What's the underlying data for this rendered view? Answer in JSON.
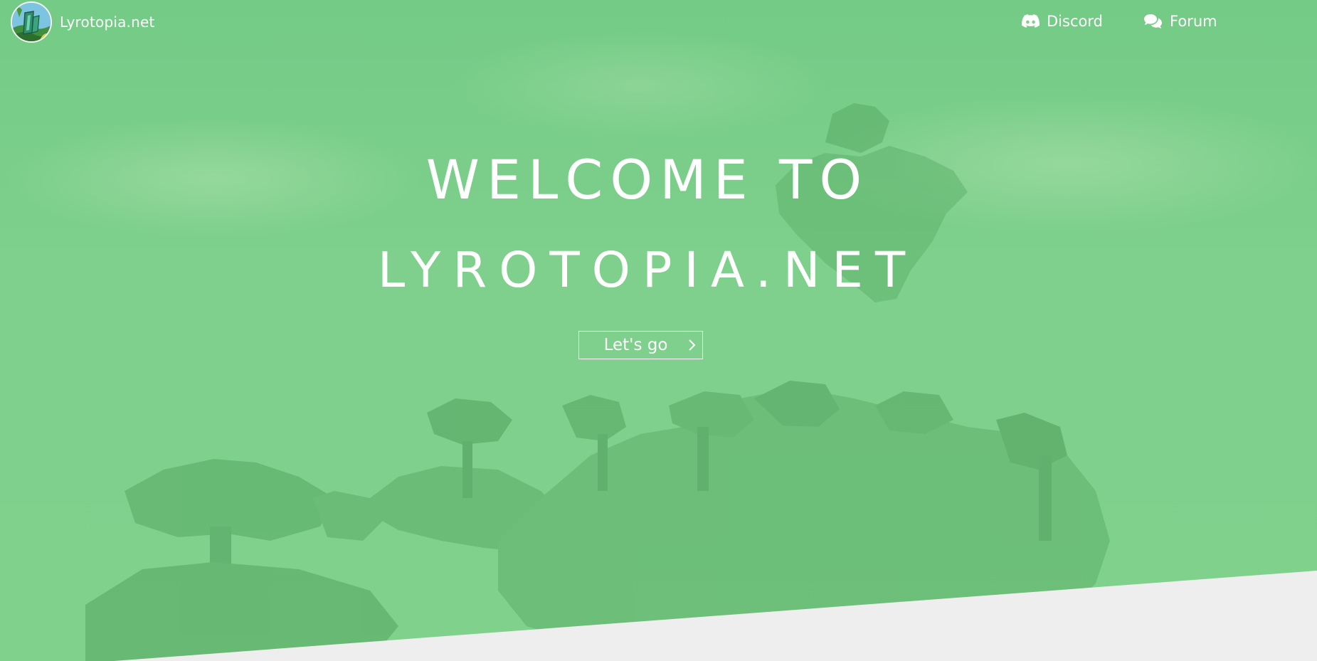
{
  "nav": {
    "brand": {
      "name": "Lyrotopia.net",
      "logo_icon": "lyrotopia-logo"
    },
    "links": [
      {
        "label": "Discord",
        "icon": "discord-icon"
      },
      {
        "label": "Forum",
        "icon": "comments-icon"
      }
    ]
  },
  "hero": {
    "title_line1": "WELCOME TO",
    "title_line2": "LYROTOPIA.NET",
    "cta_label": "Let's go",
    "cta_icon": "chevron-right-icon"
  },
  "colors": {
    "overlay_green": "#7fd08c",
    "text": "#ffffff",
    "section_bg": "#eeeeee"
  }
}
